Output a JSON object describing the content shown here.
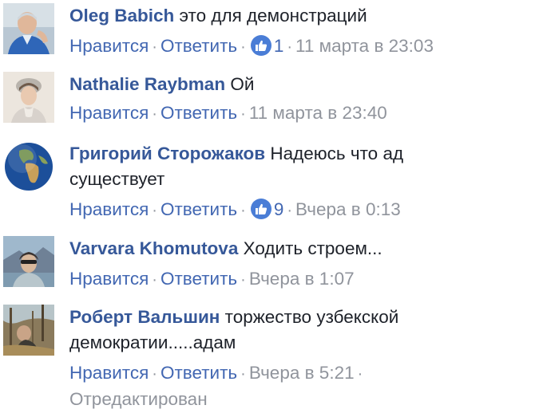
{
  "actions": {
    "like_label": "Нравится",
    "reply_label": "Ответить",
    "separator": "·",
    "edited_label": "Отредактирован"
  },
  "comments": [
    {
      "author": "Oleg Babich",
      "text": "это для демонстраций",
      "text_line2": "",
      "likes": "1",
      "time": "11 марта в 23:03",
      "avatar": "avatar-oleg-babich"
    },
    {
      "author": "Nathalie Raybman",
      "text": "Ой",
      "text_line2": "",
      "likes": "",
      "time": "11 марта в 23:40",
      "avatar": "avatar-nathalie-raybman"
    },
    {
      "author": "Григорий Сторожаков",
      "text": "Надеюсь что ад",
      "text_line2": "существует",
      "likes": "9",
      "time": "Вчера в 0:13",
      "avatar": "avatar-earth-globe"
    },
    {
      "author": "Varvara Khomutova",
      "text": "Ходить строем...",
      "text_line2": "",
      "likes": "",
      "time": "Вчера в 1:07",
      "avatar": "avatar-varvara-khomutova"
    },
    {
      "author": "Роберт Вальшин",
      "text": "торжество узбекской",
      "text_line2": "демократии.....адам",
      "likes": "",
      "time": "Вчера в 5:21",
      "edited": true,
      "avatar": "avatar-robert-valshin"
    }
  ],
  "colors": {
    "author": "#365899",
    "link": "#4267b2",
    "meta": "#90949c",
    "text": "#1d2129",
    "like_badge": "#4a7dd6"
  }
}
